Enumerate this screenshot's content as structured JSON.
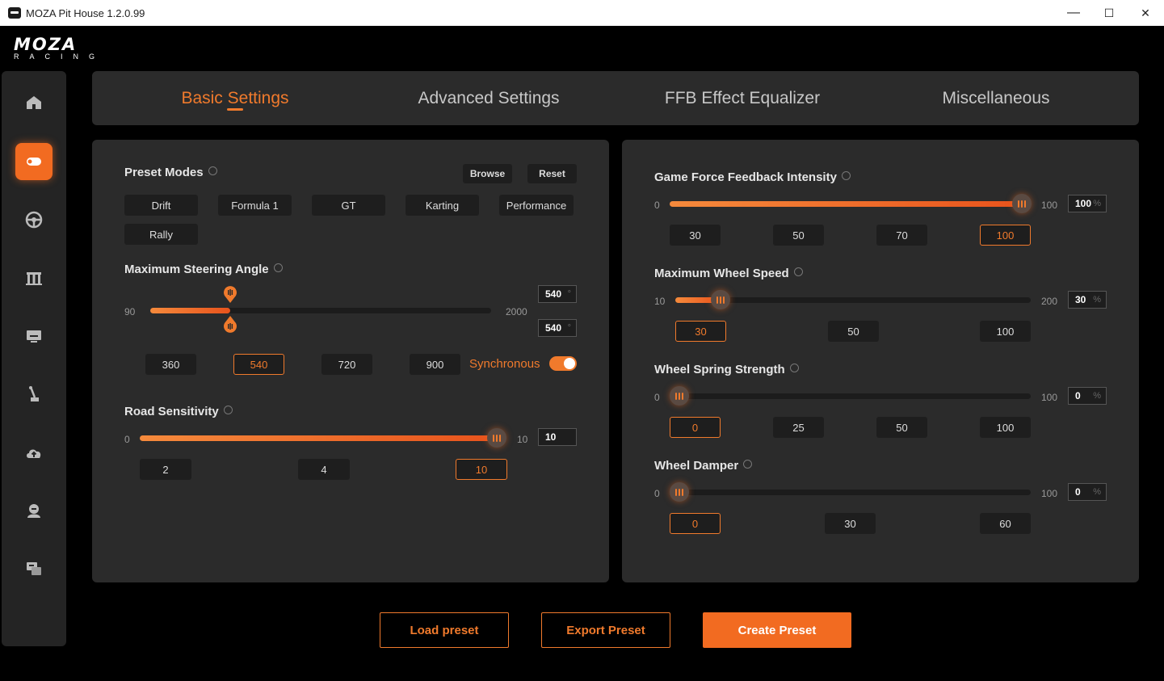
{
  "window": {
    "title": "MOZA Pit House 1.2.0.99",
    "minimize": "—",
    "maximize": "☐",
    "close": "✕"
  },
  "logo": {
    "word": "MOZA",
    "sub": "RACING"
  },
  "tabs": [
    {
      "label": "Basic Settings",
      "active": true
    },
    {
      "label": "Advanced Settings",
      "active": false
    },
    {
      "label": "FFB Effect Equalizer",
      "active": false
    },
    {
      "label": "Miscellaneous",
      "active": false
    }
  ],
  "left": {
    "preset": {
      "title": "Preset Modes",
      "browse": "Browse",
      "reset": "Reset",
      "modes": [
        "Drift",
        "Formula 1",
        "GT",
        "Karting",
        "Performance",
        "Rally"
      ]
    },
    "steering": {
      "title": "Maximum Steering Angle",
      "min": "90",
      "max": "2000",
      "value_top": "540",
      "value_bottom": "540",
      "unit": "°",
      "value": 540,
      "presets": [
        "360",
        "540",
        "720",
        "900"
      ],
      "selected": "540",
      "sync_label": "Synchronous",
      "sync_on": true
    },
    "road": {
      "title": "Road Sensitivity",
      "min": "0",
      "max": "10",
      "value": "10",
      "presets": [
        "2",
        "4",
        "10"
      ],
      "selected": "10"
    }
  },
  "right": {
    "ffb": {
      "title": "Game Force Feedback Intensity",
      "min": "0",
      "max": "100",
      "value": "100",
      "unit": "%",
      "presets": [
        "30",
        "50",
        "70",
        "100"
      ],
      "selected": "100"
    },
    "speed": {
      "title": "Maximum Wheel Speed",
      "min": "10",
      "max": "200",
      "value": "30",
      "unit": "%",
      "presets": [
        "30",
        "50",
        "100"
      ],
      "selected": "30"
    },
    "spring": {
      "title": "Wheel Spring Strength",
      "min": "0",
      "max": "100",
      "value": "0",
      "unit": "%",
      "presets": [
        "0",
        "25",
        "50",
        "100"
      ],
      "selected": "0"
    },
    "damper": {
      "title": "Wheel Damper",
      "min": "0",
      "max": "100",
      "value": "0",
      "unit": "%",
      "presets": [
        "0",
        "30",
        "60"
      ],
      "selected": "0"
    }
  },
  "bottom": {
    "load": "Load preset",
    "export": "Export Preset",
    "create": "Create Preset"
  },
  "sidebar": {
    "items": [
      {
        "icon": "home-icon",
        "active": false
      },
      {
        "icon": "wheelbase-icon",
        "active": true
      },
      {
        "icon": "steering-wheel-icon",
        "active": false
      },
      {
        "icon": "pedals-icon",
        "active": false
      },
      {
        "icon": "dashboard-icon",
        "active": false
      },
      {
        "icon": "shifter-icon",
        "active": false
      },
      {
        "icon": "cloud-upload-icon",
        "active": false
      },
      {
        "icon": "user-icon",
        "active": false
      },
      {
        "icon": "support-icon",
        "active": false
      }
    ]
  },
  "colors": {
    "accent": "#f26b21",
    "panel": "#2b2b2b",
    "background": "#000000"
  }
}
